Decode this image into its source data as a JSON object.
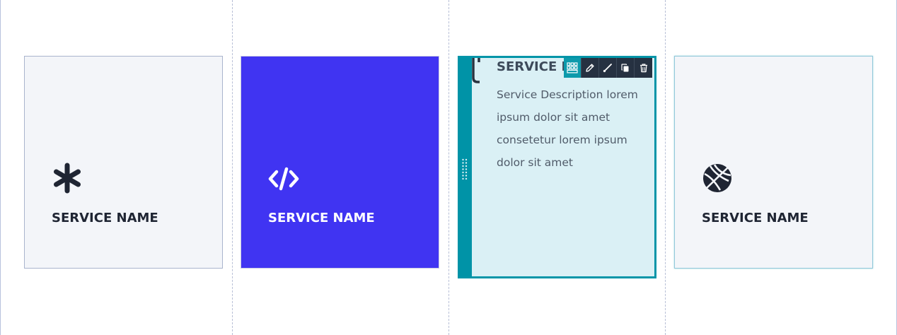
{
  "cards": [
    {
      "title": "SERVICE NAME",
      "icon": "asterisk-icon"
    },
    {
      "title": "SERVICE NAME",
      "icon": "code-icon",
      "background": "#4034f2"
    },
    {
      "title": "SERVICE N",
      "icon": "phone-icon",
      "description": "Service Description lorem ipsum dolor sit amet consetetur lorem ipsum dolor sit amet"
    },
    {
      "title": "SERVICE NAME",
      "icon": "basketball-icon"
    }
  ],
  "toolbar": {
    "buttons": [
      "grid-icon",
      "edit-pencil-icon",
      "style-brush-icon",
      "duplicate-icon",
      "delete-icon"
    ]
  },
  "colors": {
    "accent": "#0093a7",
    "blue_card": "#4034f2",
    "light_card": "#f3f5f9",
    "dark_text": "#1f2533",
    "toolbar_bg": "#263141"
  }
}
